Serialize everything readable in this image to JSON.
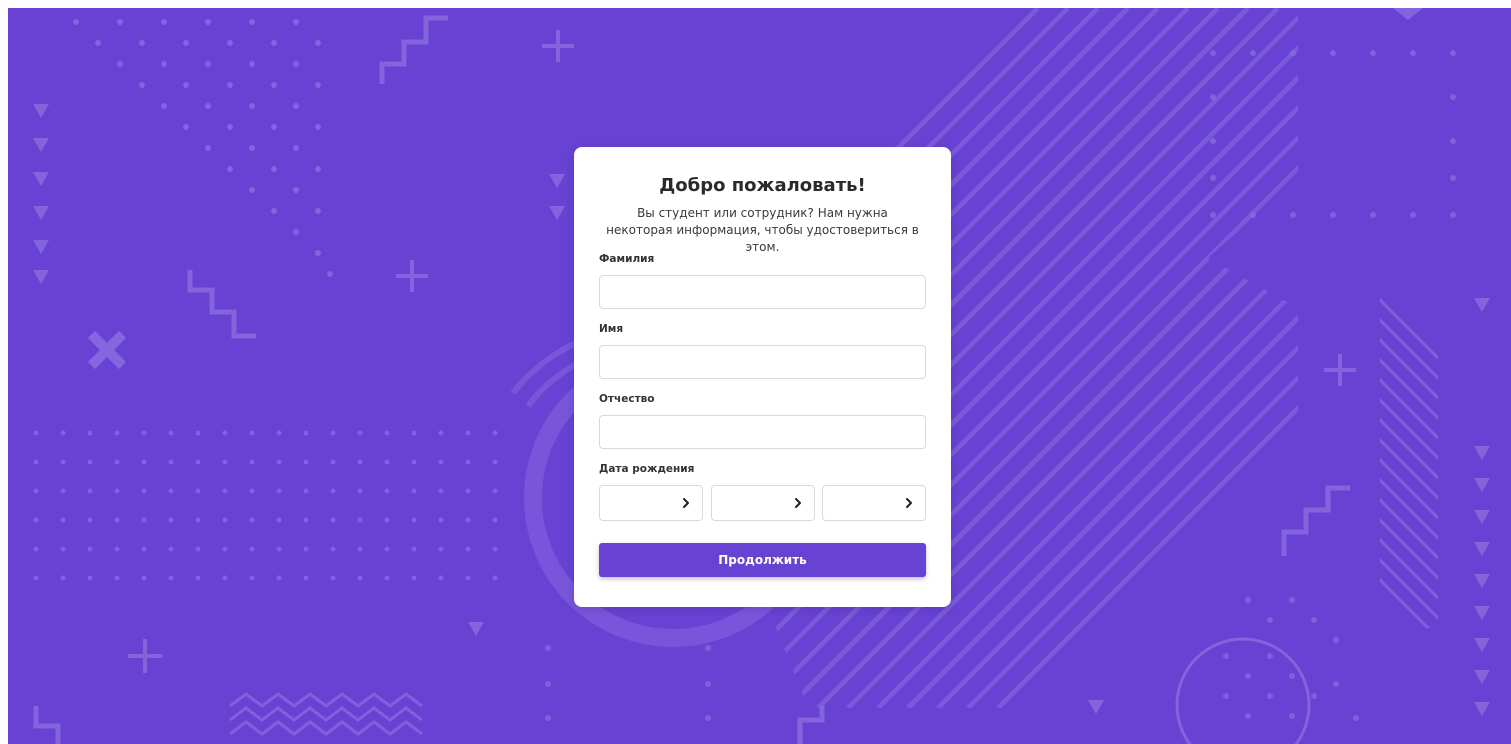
{
  "page": {
    "background_color": "#6742d3",
    "card_color": "#ffffff",
    "accent_color": "#6742d3"
  },
  "form": {
    "title": "Добро пожаловать!",
    "subtitle": "Вы студент или сотрудник? Нам нужна некоторая информация, чтобы удостовериться в этом.",
    "last_name": {
      "label": "Фамилия",
      "value": ""
    },
    "first_name": {
      "label": "Имя",
      "value": ""
    },
    "patronymic": {
      "label": "Отчество",
      "value": ""
    },
    "birth_date": {
      "label": "Дата рождения",
      "selects": [
        {
          "value": "",
          "icon": "chevron-right-icon"
        },
        {
          "value": "",
          "icon": "chevron-right-icon"
        },
        {
          "value": "",
          "icon": "chevron-right-icon"
        }
      ]
    },
    "submit_label": "Продолжить"
  }
}
